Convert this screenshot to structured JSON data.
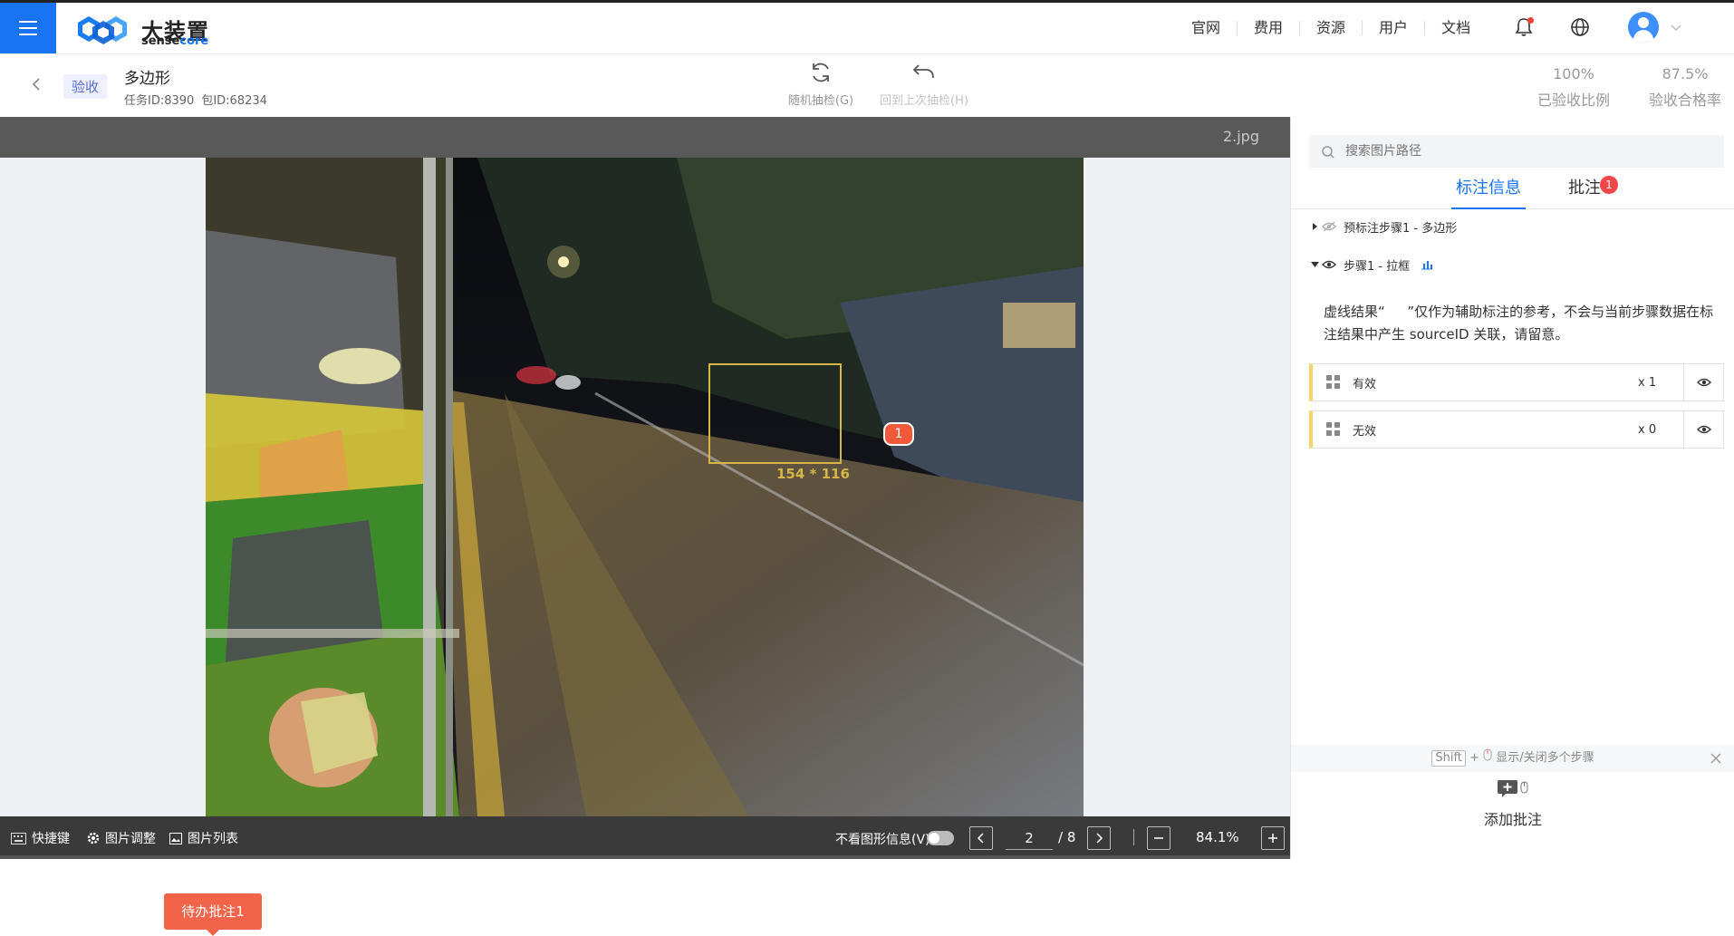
{
  "brand": {
    "name": "大装置",
    "sub_prefix": "sense",
    "sub_suffix": "core"
  },
  "nav": {
    "links": [
      "官网",
      "费用",
      "资源",
      "用户",
      "文档"
    ]
  },
  "task": {
    "tag": "验收",
    "title": "多边形",
    "task_id": "任务ID:8390",
    "package_id": "包ID:68234"
  },
  "tools": {
    "random": "随机抽检(G)",
    "back": "回到上次抽检(H)"
  },
  "stats": [
    {
      "value": "100%",
      "label": "已验收比例"
    },
    {
      "value": "87.5%",
      "label": "验收合格率"
    }
  ],
  "canvas": {
    "filename": "2.jpg",
    "bbox_size": "154 * 116",
    "bbox_badge": "1",
    "pending_label": "待办批注1"
  },
  "bottom": {
    "shortcuts": "快捷键",
    "adjust": "图片调整",
    "list": "图片列表",
    "hide_info": "不看图形信息(V)",
    "page": "2",
    "total": "/ 8",
    "zoom": "84.1%"
  },
  "panel": {
    "search_placeholder": "搜索图片路径",
    "tab_info": "标注信息",
    "tab_notes": "批注",
    "tab_notes_badge": "1",
    "pre_step": "预标注步骤1 - 多边形",
    "step": "步骤1 - 拉框",
    "notice": "虚线结果“ 　 ”仅作为辅助标注的参考，不会与当前步骤数据在标注结果中产生 sourceID 关联，请留意。",
    "classes": [
      {
        "name": "有效",
        "count": "x 1"
      },
      {
        "name": "无效",
        "count": "x 0"
      }
    ],
    "shift_key": "Shift",
    "shift_plus": "+",
    "shift_tip": "显示/关闭多个步骤",
    "add_note": "添加批注"
  },
  "colors": {
    "accent": "#1874f2",
    "badge": "#f05a3a",
    "bbox": "#d7b547"
  }
}
